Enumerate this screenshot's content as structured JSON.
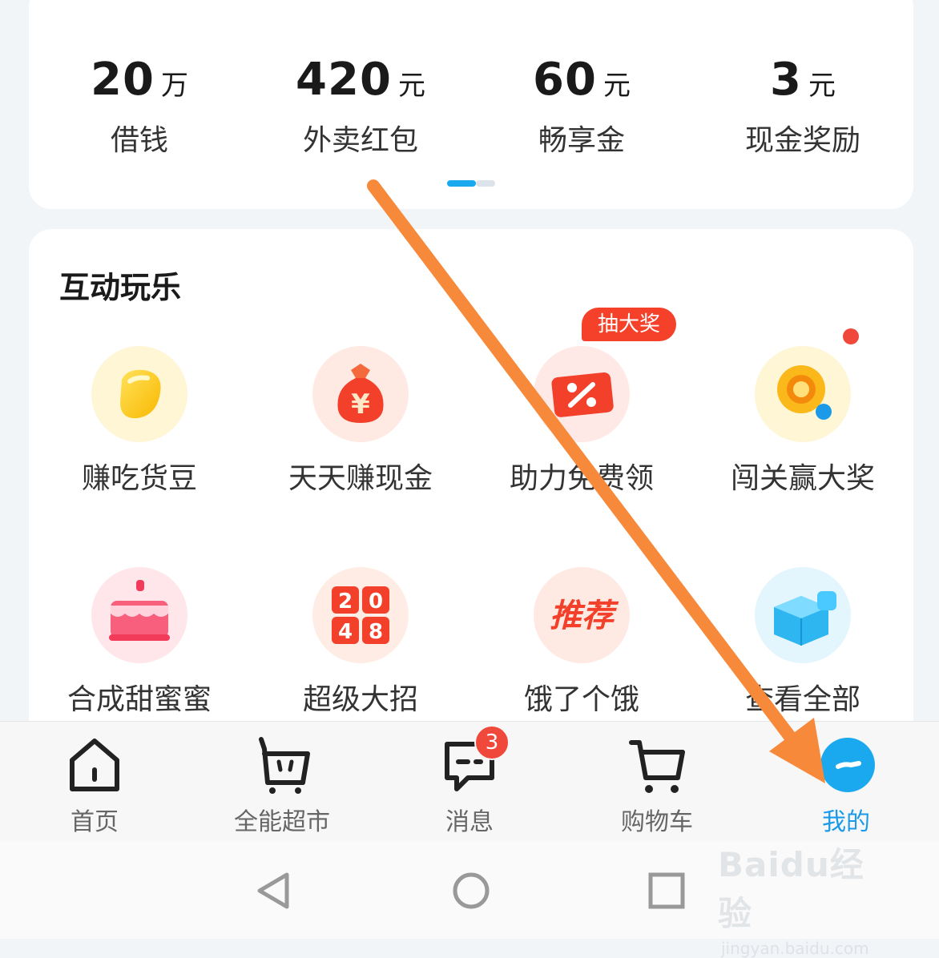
{
  "benefits": [
    {
      "value": "20",
      "unit": "万",
      "label": "借钱"
    },
    {
      "value": "420",
      "unit": "元",
      "label": "外卖红包"
    },
    {
      "value": "60",
      "unit": "元",
      "label": "畅享金"
    },
    {
      "value": "3",
      "unit": "元",
      "label": "现金奖励"
    }
  ],
  "games": {
    "title": "互动玩乐",
    "promo_tag": "抽大奖",
    "items": [
      {
        "label": "赚吃货豆",
        "icon": "bean-icon"
      },
      {
        "label": "天天赚现金",
        "icon": "money-bag-icon"
      },
      {
        "label": "助力免费领",
        "icon": "coupon-icon"
      },
      {
        "label": "闯关赢大奖",
        "icon": "magnifier-coin-icon"
      },
      {
        "label": "合成甜蜜蜜",
        "icon": "cake-icon"
      },
      {
        "label": "超级大招",
        "icon": "game-2048-icon"
      },
      {
        "label": "饿了个饿",
        "icon": "recommend-icon"
      },
      {
        "label": "查看全部",
        "icon": "cube-icon"
      }
    ],
    "icon_2048_digits": [
      "2",
      "0",
      "4",
      "8"
    ],
    "recommend_text": "推荐",
    "money_symbol": "¥"
  },
  "tabbar": {
    "items": [
      {
        "label": "首页",
        "icon": "home-icon"
      },
      {
        "label": "全能超市",
        "icon": "basket-icon"
      },
      {
        "label": "消息",
        "icon": "message-icon",
        "badge": "3"
      },
      {
        "label": "购物车",
        "icon": "cart-icon"
      },
      {
        "label": "我的",
        "icon": "profile-icon",
        "active": true
      }
    ]
  },
  "watermark": {
    "brand": "Baidu经验",
    "url": "jingyan.baidu.com"
  },
  "colors": {
    "accent": "#1a9ae8",
    "badge": "#f0483a",
    "arrow": "#f7893a"
  }
}
